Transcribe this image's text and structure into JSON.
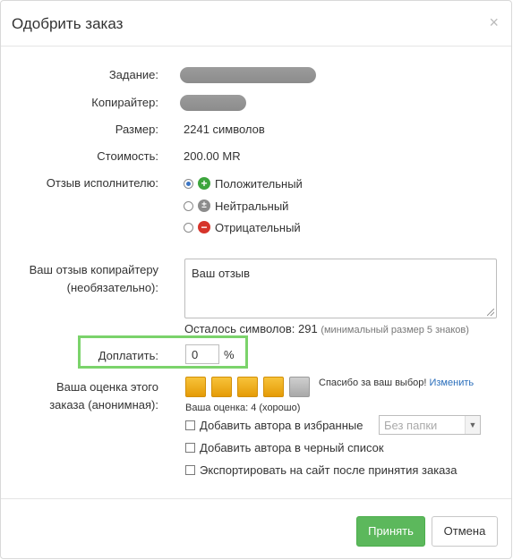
{
  "dialog": {
    "title": "Одобрить заказ",
    "close_glyph": "×"
  },
  "fields": {
    "task_label": "Задание:",
    "copywriter_label": "Копирайтер:",
    "size_label": "Размер:",
    "size_value": "2241 символов",
    "cost_label": "Стоимость:",
    "cost_value": "200.00 MR",
    "review_label": "Отзыв исполнителю:"
  },
  "review_options": [
    {
      "label": "Положительный",
      "icon": "plus-icon",
      "checked": true
    },
    {
      "label": "Нейтральный",
      "icon": "plus-minus-icon",
      "checked": false
    },
    {
      "label": "Отрицательный",
      "icon": "minus-icon",
      "checked": false
    }
  ],
  "feedback": {
    "label_line1": "Ваш отзыв копирайтеру",
    "label_line2": "(необязательно):",
    "placeholder": "Ваш отзыв",
    "remaining": "Осталось символов: 291",
    "hint": "(минимальный размер 5 знаков)"
  },
  "extra_pay": {
    "label": "Доплатить:",
    "value": "0",
    "unit": "%"
  },
  "rating": {
    "label_line1": "Ваша оценка этого",
    "label_line2": "заказа (анонимная):",
    "stars_filled": 4,
    "stars_total": 5,
    "thanks": "Спасибо за ваш выбор!",
    "change_link": "Изменить",
    "score": "Ваша оценка: 4 (хорошо)"
  },
  "options": {
    "favorites": "Добавить автора в избранные",
    "folder_select": "Без папки",
    "blacklist": "Добавить автора в черный список",
    "export": "Экспортировать на сайт после принятия заказа"
  },
  "buttons": {
    "accept": "Принять",
    "cancel": "Отмена"
  },
  "colors": {
    "accept_green": "#5cb85c",
    "highlight_green": "#7bd36b",
    "star_gold": "#f0b320",
    "link_blue": "#2a6ebb"
  }
}
